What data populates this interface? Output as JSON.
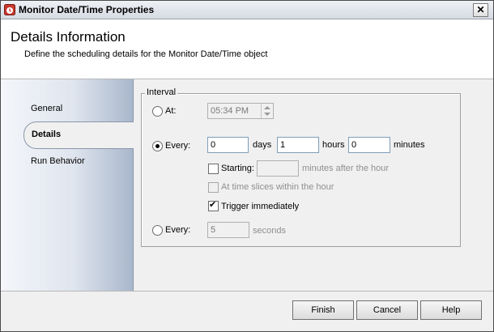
{
  "window": {
    "title": "Monitor Date/Time Properties",
    "close_symbol": "✕"
  },
  "header": {
    "title": "Details Information",
    "subtitle": "Define the scheduling details for the Monitor Date/Time object"
  },
  "sidebar": {
    "items": [
      {
        "label": "General"
      },
      {
        "label": "Details",
        "selected": true
      },
      {
        "label": "Run Behavior"
      }
    ]
  },
  "interval": {
    "legend": "Interval",
    "at": {
      "label": "At:",
      "time_value": "05:34 PM",
      "selected": false
    },
    "every": {
      "label": "Every:",
      "selected": true,
      "days_value": "0",
      "days_label": "days",
      "hours_value": "1",
      "hours_label": "hours",
      "minutes_value": "0",
      "minutes_label": "minutes"
    },
    "starting": {
      "label": "Starting:",
      "value": "",
      "suffix": "minutes after the hour",
      "checked": false
    },
    "time_slices": {
      "label": "At time slices within the hour",
      "checked": false,
      "disabled": true
    },
    "trigger": {
      "label": "Trigger immediately",
      "checked": true
    },
    "every_seconds": {
      "label": "Every:",
      "value": "5",
      "unit": "seconds",
      "selected": false
    }
  },
  "footer": {
    "finish": "Finish",
    "cancel": "Cancel",
    "help": "Help"
  }
}
